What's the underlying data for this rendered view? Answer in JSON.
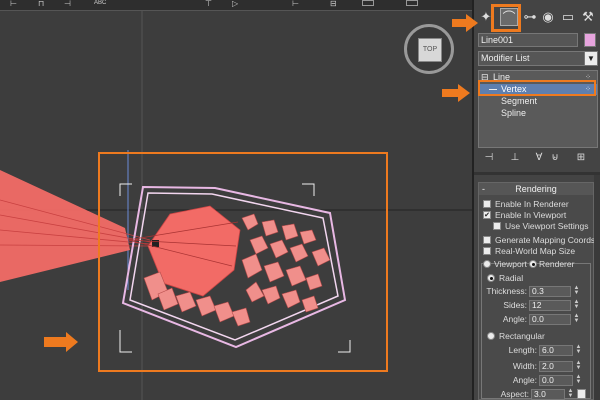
{
  "viewport": {
    "viewcube_label": "TOP",
    "top_icons": [
      "⊢",
      "⊓",
      "⊣",
      "ABC",
      "⊤",
      "▷",
      "⊢",
      "⊟"
    ]
  },
  "panel": {
    "tabs": [
      "✦",
      "⌒",
      "⊶",
      "◉",
      "▭",
      "⚒"
    ],
    "active_tab_icon": "modify-icon",
    "object_name": "Line001",
    "object_color": "#e6a4dd",
    "modifier_list_label": "Modifier List",
    "modifier_list_arrow": "▼",
    "stack": {
      "root": "Line",
      "root_toggle": "⊟",
      "items": [
        "Vertex",
        "Segment",
        "Spline"
      ]
    },
    "tool_icons": [
      "⊣",
      "⊥",
      "∀",
      "⊌",
      "⊞"
    ],
    "rendering": {
      "title": "Rendering",
      "collapse": "-",
      "enable_in_renderer": "Enable In Renderer",
      "enable_in_viewport": "Enable In Viewport",
      "use_viewport_settings": "Use Viewport Settings",
      "generate_mapping": "Generate Mapping Coords.",
      "real_world_map_size": "Real-World Map Size",
      "viewport": "Viewport",
      "renderer": "Renderer",
      "radial": "Radial",
      "thickness_label": "Thickness:",
      "thickness": "0.3",
      "sides_label": "Sides:",
      "sides": "12",
      "angle_label": "Angle:",
      "angle": "0.0",
      "rectangular": "Rectangular",
      "length_label": "Length:",
      "length": "6.0",
      "width_label": "Width:",
      "width": "2.0",
      "angle2_label": "Angle:",
      "angle2": "0.0",
      "aspect_label": "Aspect:",
      "aspect": "3.0"
    }
  },
  "accent": "#ee7a1f"
}
